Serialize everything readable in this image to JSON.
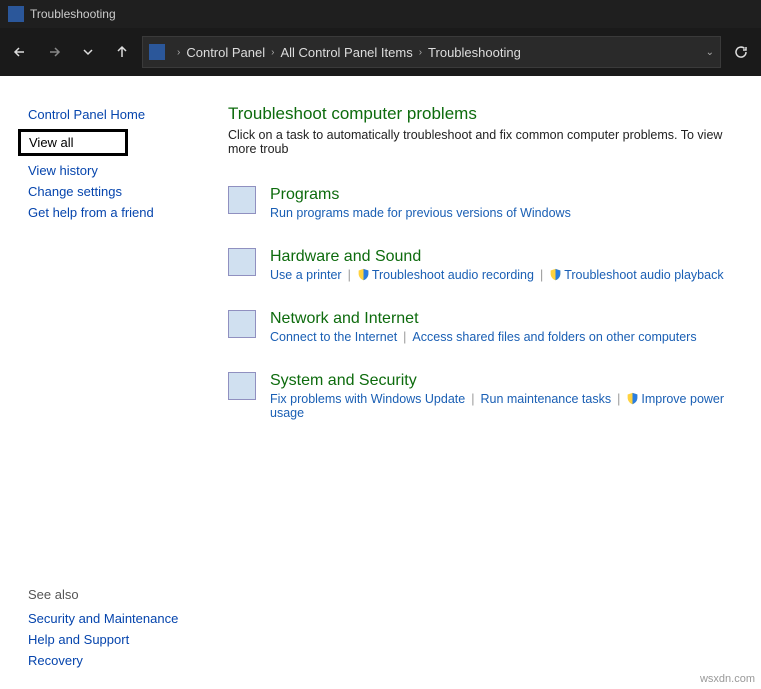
{
  "window": {
    "title": "Troubleshooting"
  },
  "breadcrumb": {
    "items": [
      "Control Panel",
      "All Control Panel Items",
      "Troubleshooting"
    ]
  },
  "sidebar": {
    "home": "Control Panel Home",
    "view_all": "View all",
    "view_history": "View history",
    "change_settings": "Change settings",
    "get_help": "Get help from a friend"
  },
  "see_also": {
    "heading": "See also",
    "items": [
      "Security and Maintenance",
      "Help and Support",
      "Recovery"
    ]
  },
  "main": {
    "heading": "Troubleshoot computer problems",
    "intro": "Click on a task to automatically troubleshoot and fix common computer problems. To view more troub"
  },
  "categories": [
    {
      "title": "Programs",
      "links": [
        {
          "label": "Run programs made for previous versions of Windows",
          "shield": false
        }
      ]
    },
    {
      "title": "Hardware and Sound",
      "links": [
        {
          "label": "Use a printer",
          "shield": false
        },
        {
          "label": "Troubleshoot audio recording",
          "shield": true
        },
        {
          "label": "Troubleshoot audio playback",
          "shield": true
        }
      ]
    },
    {
      "title": "Network and Internet",
      "links": [
        {
          "label": "Connect to the Internet",
          "shield": false
        },
        {
          "label": "Access shared files and folders on other computers",
          "shield": false
        }
      ]
    },
    {
      "title": "System and Security",
      "links": [
        {
          "label": "Fix problems with Windows Update",
          "shield": false
        },
        {
          "label": "Run maintenance tasks",
          "shield": false
        },
        {
          "label": "Improve power usage",
          "shield": true
        }
      ]
    }
  ],
  "watermark": "wsxdn.com"
}
